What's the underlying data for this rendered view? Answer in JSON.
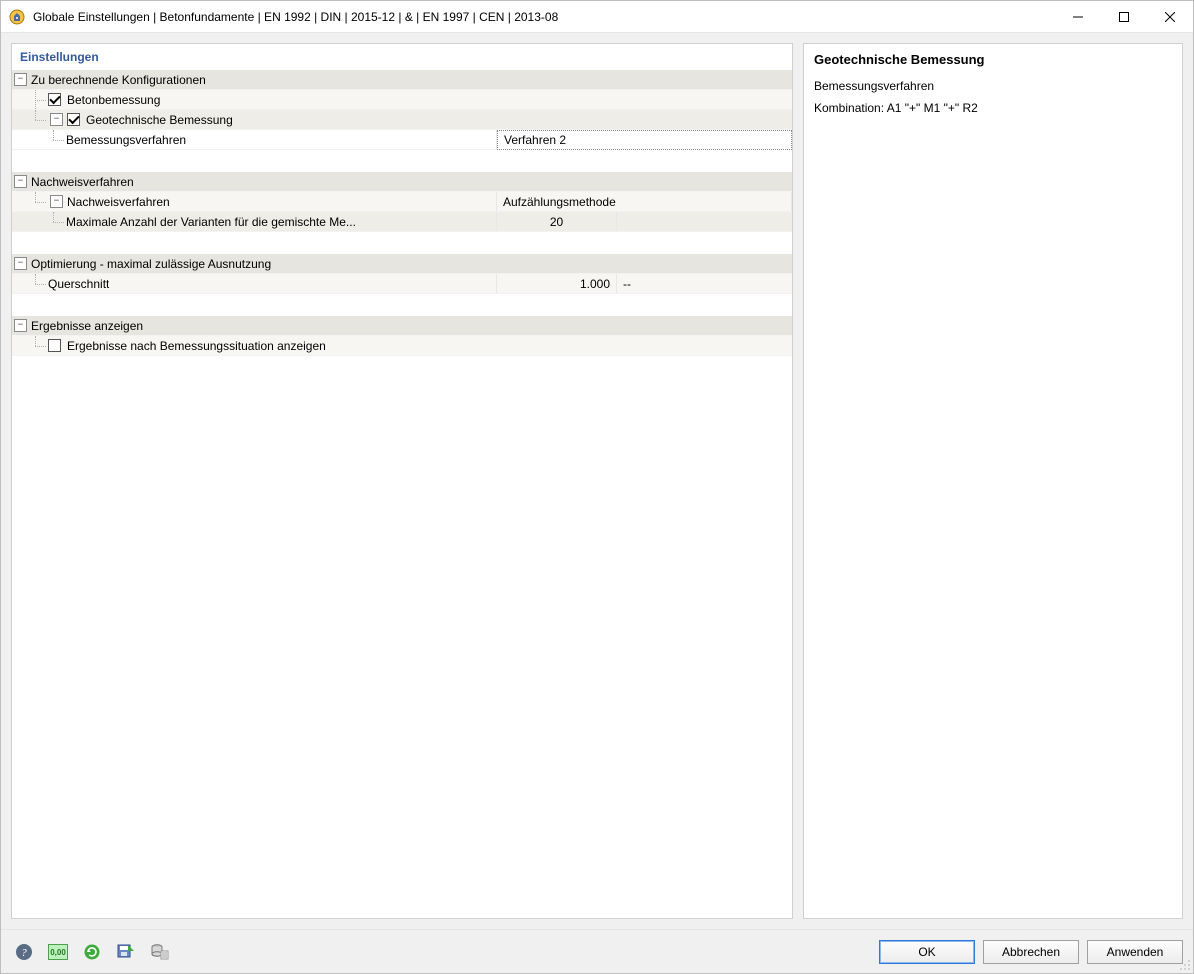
{
  "titlebar": {
    "title": "Globale Einstellungen | Betonfundamente | EN 1992 | DIN | 2015-12 | & | EN 1997 | CEN | 2013-08"
  },
  "left_panel": {
    "header": "Einstellungen",
    "groups": {
      "configs": {
        "label": "Zu berechnende Konfigurationen",
        "item_concrete": "Betonbemessung",
        "item_geo": "Geotechnische Bemessung",
        "item_geo_method_label": "Bemessungsverfahren",
        "item_geo_method_value": "Verfahren 2"
      },
      "nachweis": {
        "label": "Nachweisverfahren",
        "sub_label": "Nachweisverfahren",
        "sub_value": "Aufzählungsmethode",
        "max_variants_label": "Maximale Anzahl der Varianten für die gemischte Me...",
        "max_variants_value": "20"
      },
      "optimierung": {
        "label": "Optimierung - maximal zulässige Ausnutzung",
        "querschnitt_label": "Querschnitt",
        "querschnitt_value": "1.000",
        "querschnitt_unit": "--"
      },
      "ergebnisse": {
        "label": "Ergebnisse anzeigen",
        "item_label": "Ergebnisse nach Bemessungssituation anzeigen"
      }
    }
  },
  "right_panel": {
    "title": "Geotechnische Bemessung",
    "line1": "Bemessungsverfahren",
    "line2": "Kombination: A1 \"+\" M1 \"+\" R2"
  },
  "footer": {
    "ok": "OK",
    "cancel": "Abbrechen",
    "apply": "Anwenden"
  }
}
